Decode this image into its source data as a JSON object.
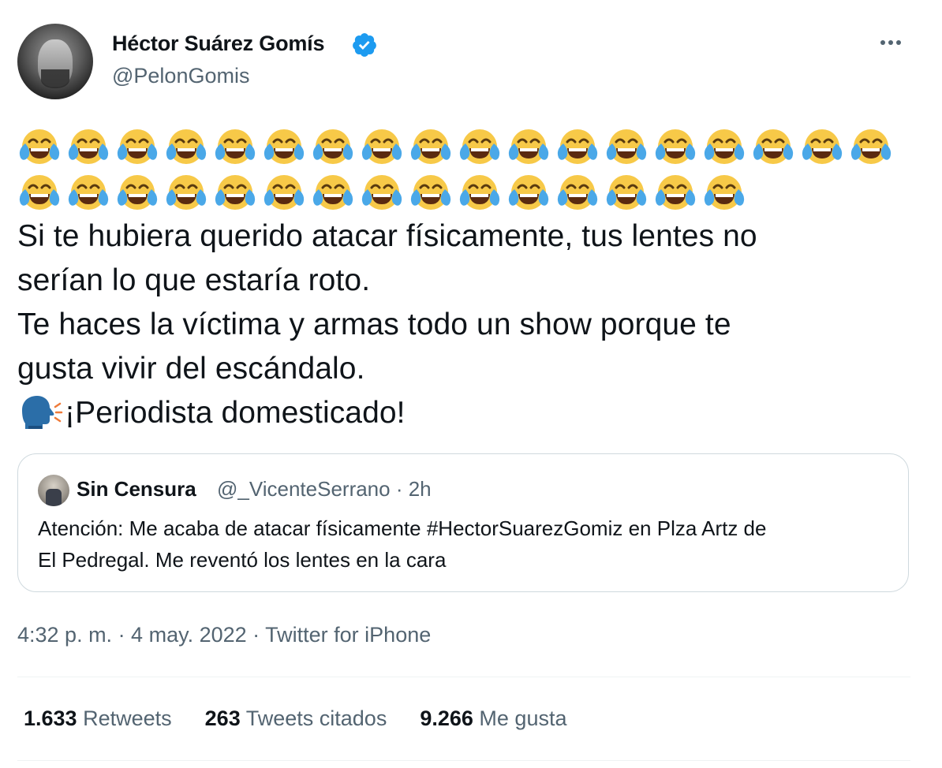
{
  "author": {
    "display_name": "Héctor Suárez Gomís",
    "handle": "@PelonGomis",
    "verified": true,
    "avatar_icon": "profile-photo"
  },
  "more_icon": "more-horizontal-icon",
  "tweet": {
    "emoji": "face-with-tears-of-joy",
    "emoji_row_counts": [
      18,
      15
    ],
    "lines": [
      "Si te hubiera querido atacar físicamente, tus lentes no",
      "serían lo que estaría roto.",
      "Te haces la víctima y armas todo un show porque te",
      "gusta vivir del escándalo."
    ],
    "last_line_emoji": "speaking-head",
    "last_line": "¡Periodista domesticado!"
  },
  "quoted_tweet": {
    "display_name": "Sin Censura",
    "handle_time": "@_VicenteSerrano · 2h",
    "lines": [
      "Atención: Me acaba de atacar físicamente #HectorSuarezGomiz en Plza Artz de",
      "El Pedregal. Me reventó los lentes en la cara"
    ]
  },
  "meta": "4:32 p. m. · 4 may. 2022 · Twitter for iPhone",
  "stats": [
    {
      "value": "1.633",
      "label": "Retweets"
    },
    {
      "value": "263",
      "label": "Tweets citados"
    },
    {
      "value": "9.266",
      "label": "Me gusta"
    }
  ],
  "colors": {
    "text": "#0f1419",
    "secondary": "#536471",
    "verified": "#1d9bf0",
    "border": "#cfd9de",
    "divider": "#eff3f4"
  }
}
